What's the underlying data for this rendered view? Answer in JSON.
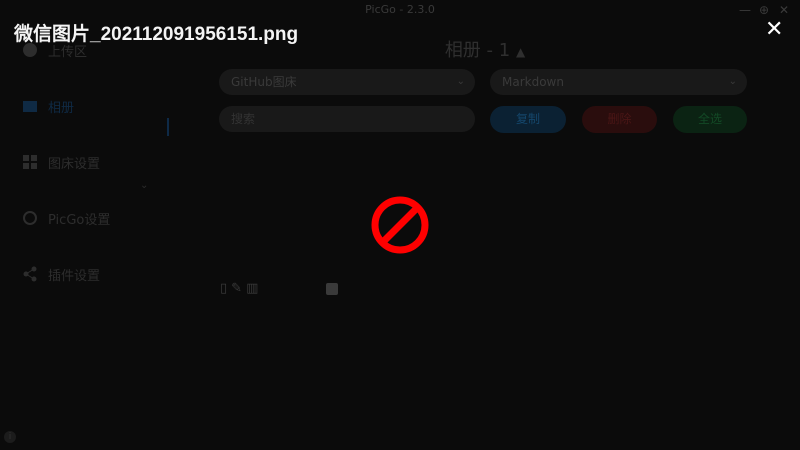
{
  "window": {
    "title": "PicGo - 2.3.0"
  },
  "sidebar": {
    "items": [
      {
        "label": "上传区",
        "icon": "upload-icon"
      },
      {
        "label": "相册",
        "icon": "image-icon",
        "active": true
      },
      {
        "label": "图床设置",
        "icon": "grid-icon"
      },
      {
        "label": "PicGo设置",
        "icon": "settings-icon"
      },
      {
        "label": "插件设置",
        "icon": "share-icon"
      }
    ],
    "version_label": "i"
  },
  "gallery": {
    "title": "相册 - 1",
    "bed_select": {
      "value": "GitHub图床"
    },
    "format_select": {
      "value": "Markdown"
    },
    "search": {
      "placeholder": "搜索"
    },
    "buttons": {
      "copy": "复制",
      "delete": "删除",
      "select_all": "全选"
    }
  },
  "overlay": {
    "filename": "微信图片_20211209195615​1.png",
    "close": "✕"
  },
  "colors": {
    "background": "#0b0b0b",
    "broken_icon": "#ff0000"
  }
}
